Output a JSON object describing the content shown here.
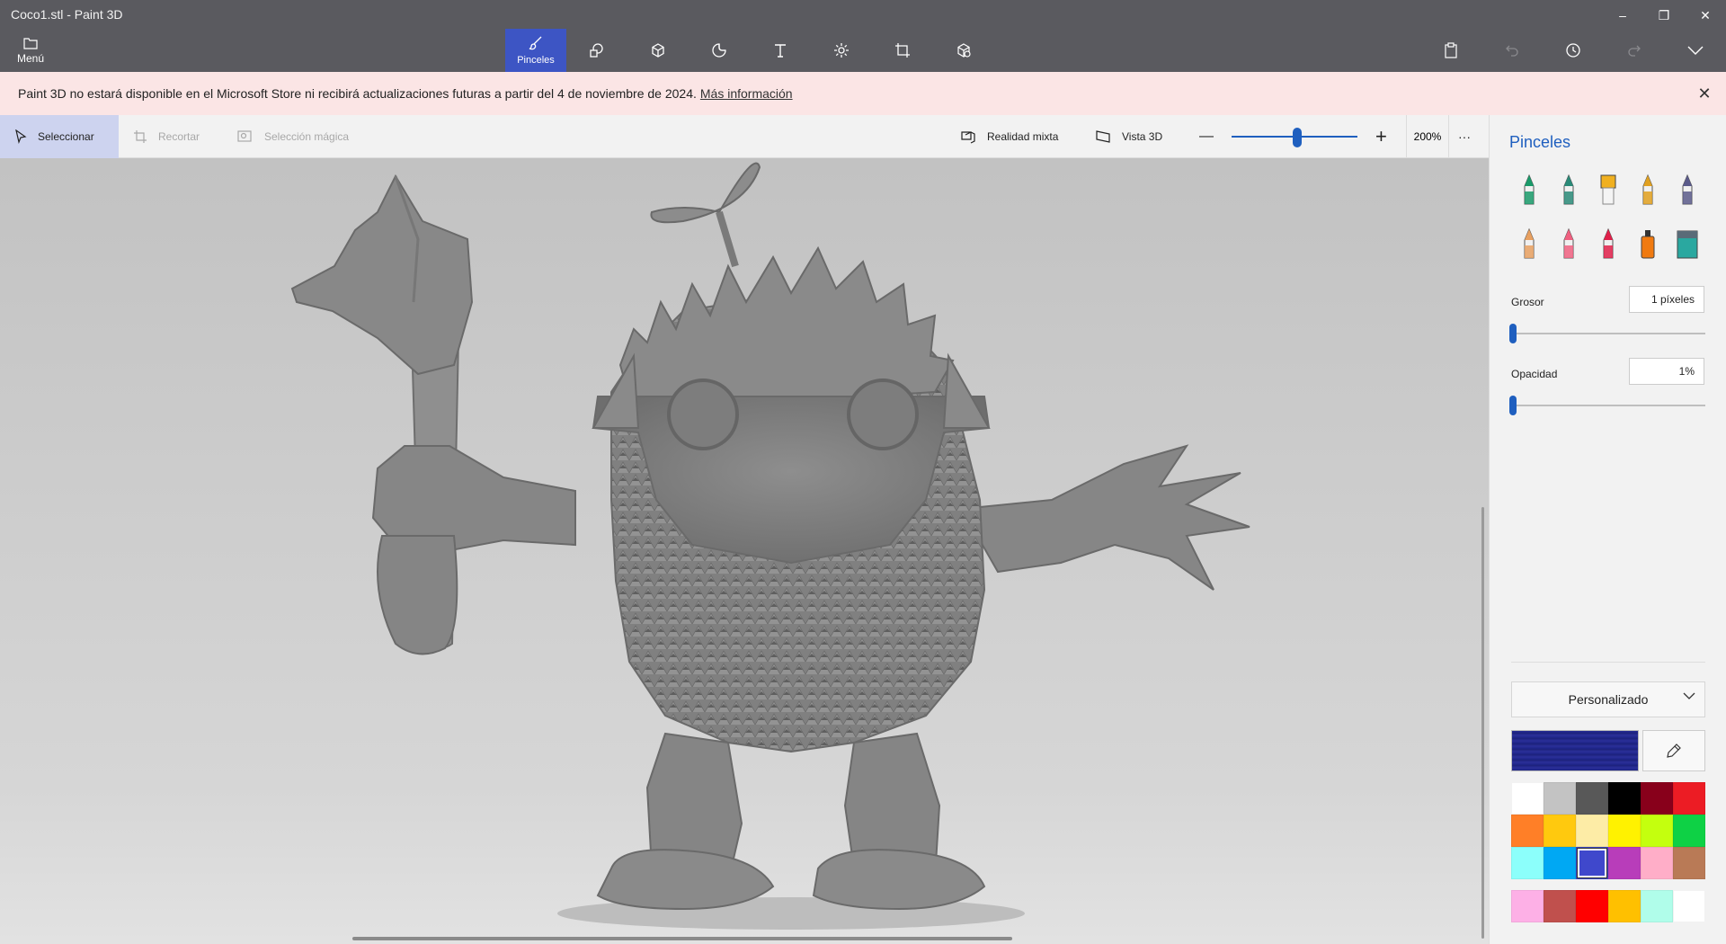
{
  "window": {
    "title": "Coco1.stl - Paint 3D"
  },
  "titlebar": {
    "minimize": "–",
    "restore": "❐",
    "close": "✕"
  },
  "ribbon": {
    "menu_label": "Menú",
    "tools": [
      {
        "name": "brushes",
        "label": "Pinceles",
        "active": true,
        "icon": "brush-icon"
      },
      {
        "name": "2d-shapes",
        "label": "",
        "active": false,
        "icon": "2d-shapes-icon"
      },
      {
        "name": "3d-shapes",
        "label": "",
        "active": false,
        "icon": "cube-icon"
      },
      {
        "name": "stickers",
        "label": "",
        "active": false,
        "icon": "sticker-icon"
      },
      {
        "name": "text",
        "label": "",
        "active": false,
        "icon": "text-icon"
      },
      {
        "name": "effects",
        "label": "",
        "active": false,
        "icon": "sun-icon"
      },
      {
        "name": "canvas",
        "label": "",
        "active": false,
        "icon": "crop-canvas-icon"
      },
      {
        "name": "3d-library",
        "label": "",
        "active": false,
        "icon": "3d-library-icon"
      }
    ],
    "right_icons": [
      "paste-icon",
      "undo-icon",
      "history-icon",
      "redo-icon",
      "expand-icon"
    ]
  },
  "notice": {
    "text": "Paint 3D no estará disponible en el Microsoft Store ni recibirá actualizaciones futuras a partir del 4 de noviembre de 2024.",
    "link": "Más información",
    "close": "✕"
  },
  "canvas_toolbar": {
    "select": "Seleccionar",
    "crop": "Recortar",
    "magic_select": "Selección mágica",
    "mixed_reality": "Realidad mixta",
    "view_3d": "Vista 3D",
    "zoom_minus": "—",
    "zoom_plus": "+",
    "zoom_value": "200%",
    "more": "···",
    "zoom_level": 0.52
  },
  "panel": {
    "title": "Pinceles",
    "brushes": [
      {
        "icon": "marker-icon",
        "color": "#1a9a6a"
      },
      {
        "icon": "calligraphy-pen-icon",
        "color": "#2a8a78"
      },
      {
        "icon": "oil-brush-icon",
        "color": "#f0b020"
      },
      {
        "icon": "watercolor-icon",
        "color": "#e0a020"
      },
      {
        "icon": "pixel-pen-icon",
        "color": "#5a5a8a"
      },
      {
        "icon": "pencil-icon",
        "color": "#e8a060"
      },
      {
        "icon": "eraser-icon",
        "color": "#f06080"
      },
      {
        "icon": "crayon-icon",
        "color": "#e0204a"
      },
      {
        "icon": "spray-can-icon",
        "color": "#f07a10"
      },
      {
        "icon": "fill-bucket-icon",
        "color": "#2aa8a0"
      }
    ],
    "thickness_label": "Grosor",
    "thickness_value": "1 píxeles",
    "thickness_level": 0.0,
    "opacity_label": "Opacidad",
    "opacity_value": "1%",
    "opacity_level": 0.0,
    "palette_dropdown": "Personalizado",
    "current_color": "#1c2383",
    "palette": [
      "#ffffff",
      "#c3c3c3",
      "#585858",
      "#000000",
      "#88001b",
      "#ec1c24",
      "#ff7f27",
      "#ffc90e",
      "#fdeca6",
      "#fff200",
      "#c4ff0e",
      "#0ed145",
      "#8cfffb",
      "#00a8f3",
      "#3f48cc",
      "#b83dba",
      "#ffaec8",
      "#b97a56"
    ],
    "selected_swatch": 14,
    "custom_colors": [
      "#fdb0e6",
      "#c0504d",
      "#ff0000",
      "#ffc000",
      "#b0fdea",
      "#ffffff"
    ]
  }
}
